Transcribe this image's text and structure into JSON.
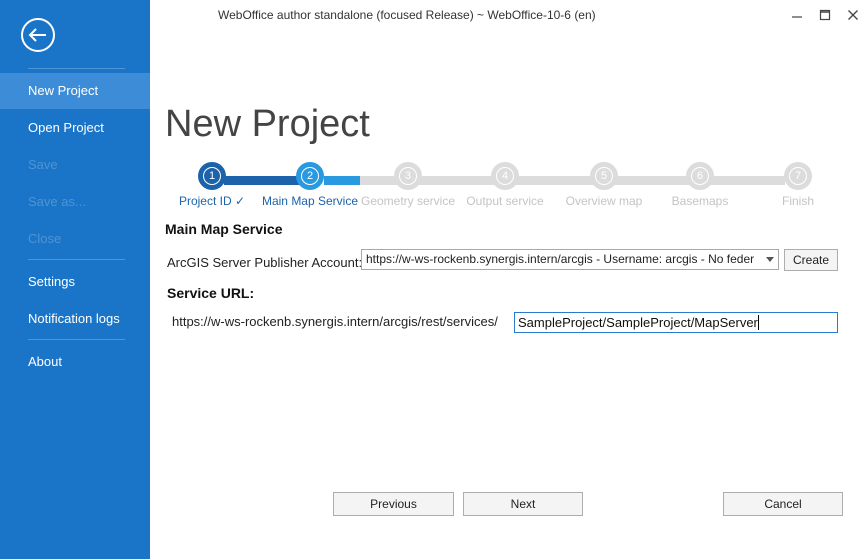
{
  "window": {
    "title": "WebOffice author standalone (focused Release) ~ WebOffice-10-6 (en)"
  },
  "sidebar": {
    "items": [
      {
        "label": "New Project"
      },
      {
        "label": "Open Project"
      },
      {
        "label": "Save"
      },
      {
        "label": "Save as..."
      },
      {
        "label": "Close"
      },
      {
        "label": "Settings"
      },
      {
        "label": "Notification logs"
      },
      {
        "label": "About"
      }
    ]
  },
  "page": {
    "title": "New Project"
  },
  "wizard": {
    "steps": [
      {
        "number": "1",
        "label": "Project ID ✓",
        "state": "done"
      },
      {
        "number": "2",
        "label": "Main Map Service",
        "state": "current"
      },
      {
        "number": "3",
        "label": "Geometry service",
        "state": "pending"
      },
      {
        "number": "4",
        "label": "Output service",
        "state": "pending"
      },
      {
        "number": "5",
        "label": "Overview map",
        "state": "pending"
      },
      {
        "number": "6",
        "label": "Basemaps",
        "state": "pending"
      },
      {
        "number": "7",
        "label": "Finish",
        "state": "pending"
      }
    ]
  },
  "form": {
    "heading": "Main Map Service",
    "account_label": "ArcGIS Server Publisher Account:",
    "account_value": "https://w-ws-rockenb.synergis.intern/arcgis  -  Username: arcgis - No feder",
    "create_label": "Create",
    "service_url_heading": "Service URL:",
    "service_url_prefix": "https://w-ws-rockenb.synergis.intern/arcgis/rest/services/",
    "service_url_value": "SampleProject/SampleProject/MapServer"
  },
  "footer": {
    "previous_label": "Previous",
    "next_label": "Next",
    "cancel_label": "Cancel"
  },
  "colors": {
    "sidebar_bg": "#1a75c8",
    "sidebar_active": "#3d8cd8",
    "step_done": "#1c63ac",
    "step_current": "#2a9ae0",
    "step_pending": "#dcdcdc"
  },
  "icons": {
    "back": "back-arrow-icon",
    "minimize": "minimize-icon",
    "maximize": "maximize-icon",
    "close": "close-icon",
    "dropdown": "chevron-down-icon"
  }
}
